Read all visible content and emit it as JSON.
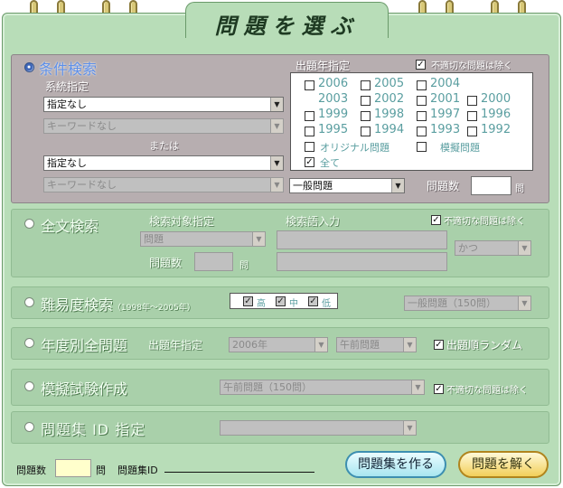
{
  "title": "問題を選ぶ",
  "sections": {
    "condition": {
      "title": "条件検索",
      "category_label": "系統指定",
      "category1_value": "指定なし",
      "keyword1_value": "キーワードなし",
      "or_label": "または",
      "category2_value": "指定なし",
      "keyword2_value": "キーワードなし",
      "year_label": "出題年指定",
      "exclude_label": "不適切な問題は除く",
      "years": [
        "2006",
        "2005",
        "2004",
        "2003",
        "2002",
        "2001",
        "2000",
        "1999",
        "1998",
        "1997",
        "1996",
        "1995",
        "1994",
        "1993",
        "1992"
      ],
      "original_label": "オリジナル問題",
      "mock_label": "模擬問題",
      "all_label": "全て",
      "type_value": "一般問題",
      "count_label": "問題数",
      "count_unit": "問"
    },
    "fulltext": {
      "title": "全文検索",
      "target_label": "検索対象指定",
      "target_value": "問題",
      "term_label": "検索語入力",
      "exclude_label": "不適切な問題は除く",
      "logic_value": "かつ",
      "count_label": "問題数",
      "count_unit": "問"
    },
    "difficulty": {
      "title": "難易度検索",
      "range": "（1998年～2005年）",
      "high": "高",
      "mid": "中",
      "low": "低",
      "type_value": "一般問題（150問）"
    },
    "yearly": {
      "title": "年度別全問題",
      "year_label": "出題年指定",
      "year_value": "2006年",
      "session_value": "午前問題",
      "random_label": "出題順ランダム"
    },
    "mock": {
      "title": "模擬試験作成",
      "type_value": "午前問題（150問）",
      "exclude_label": "不適切な問題は除く"
    },
    "set_id": {
      "title": "問題集 ID 指定"
    }
  },
  "footer": {
    "count_label": "問題数",
    "count_unit": "問",
    "set_id_label": "問題集ID",
    "make_button": "問題集を作る",
    "solve_button": "問題を解く"
  },
  "colors": {
    "board": "#b8ddb8",
    "panel": "#a9d0aa",
    "active_panel": "#b7aeb0",
    "accent_blue": "#5d8fe8",
    "year_text": "#5a9ea0"
  }
}
